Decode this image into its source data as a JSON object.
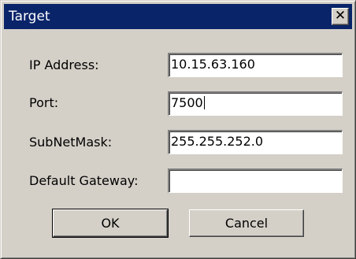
{
  "window": {
    "title": "Target",
    "close_glyph": "✕"
  },
  "fields": [
    {
      "label": "IP Address:",
      "value": "10.15.63.160"
    },
    {
      "label": "Port:",
      "value": "7500"
    },
    {
      "label": "SubNetMask:",
      "value": "255.255.252.0"
    },
    {
      "label": "Default Gateway:",
      "value": ""
    }
  ],
  "buttons": {
    "ok_label": "OK",
    "cancel_label": "Cancel"
  }
}
